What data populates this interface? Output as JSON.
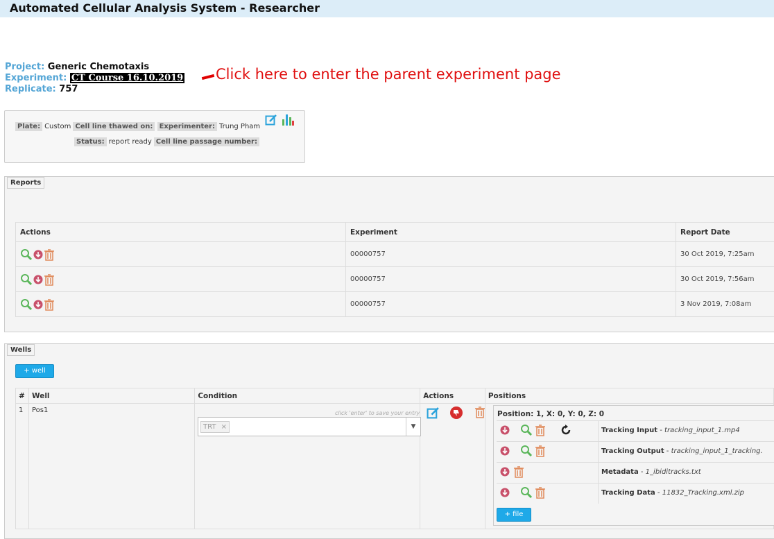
{
  "app": {
    "title": "Automated Cellular Analysis System - Researcher"
  },
  "meta": {
    "project_label": "Project:",
    "project_value": "Generic Chemotaxis",
    "experiment_label": "Experiment:",
    "experiment_value": "CT Course 16.10.2019",
    "replicate_label": "Replicate:",
    "replicate_value": "757"
  },
  "callout": {
    "text": "Click here to enter the parent experiment page"
  },
  "info": {
    "plate_label": "Plate:",
    "plate_value": "Custom",
    "thawed_label": "Cell line thawed on:",
    "experimenter_label": "Experimenter:",
    "experimenter_value": "Trung Pham",
    "status_label": "Status:",
    "status_value": "report ready",
    "passage_label": "Cell line passage number:"
  },
  "reports": {
    "legend": "Reports",
    "columns": [
      "Actions",
      "Experiment",
      "Report Date"
    ],
    "rows": [
      {
        "experiment": "00000757",
        "date": "30 Oct 2019, 7:25am"
      },
      {
        "experiment": "00000757",
        "date": "30 Oct 2019, 7:56am"
      },
      {
        "experiment": "00000757",
        "date": "3 Nov 2019, 7:08am"
      }
    ]
  },
  "wells": {
    "legend": "Wells",
    "add_button": "+ well",
    "columns": [
      "#",
      "Well",
      "Condition",
      "Actions",
      "Positions"
    ],
    "row": {
      "index": "1",
      "well": "Pos1",
      "condition_hint": "click 'enter' to save your entry",
      "condition_chip": "TRT",
      "chip_remove": "×"
    },
    "position": {
      "header": "Position: 1, X: 0, Y: 0, Z: 0",
      "files": [
        {
          "label": "Tracking Input",
          "name": "tracking_input_1.mp4"
        },
        {
          "label": "Tracking Output",
          "name": "tracking_input_1_tracking."
        },
        {
          "label": "Metadata",
          "name": "1_ibiditracks.txt"
        },
        {
          "label": "Tracking Data",
          "name": "11832_Tracking.xml.zip"
        }
      ],
      "separator": " - ",
      "add_file_button": "+ file"
    }
  },
  "colors": {
    "accent": "#1ea9e8",
    "label_blue": "#55a6d6",
    "callout_red": "#e01010"
  }
}
